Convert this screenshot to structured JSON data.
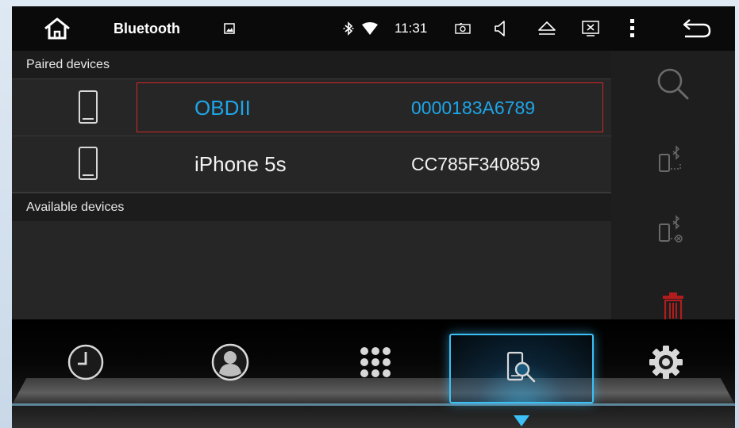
{
  "status_bar": {
    "title": "Bluetooth",
    "time": "11:31",
    "icons": [
      "home-icon",
      "image-icon",
      "bluetooth-icon",
      "wifi-icon",
      "radio-icon",
      "volume-icon",
      "eject-icon",
      "close-app-icon",
      "menu-icon",
      "back-icon"
    ]
  },
  "paired_header": "Paired devices",
  "available_header": "Available devices",
  "devices": [
    {
      "name": "OBDII",
      "address": "0000183A6789",
      "selected": true
    },
    {
      "name": "iPhone 5s",
      "address": "CC785F340859",
      "selected": false
    }
  ],
  "actions": [
    "search-icon",
    "pair-device-icon",
    "unpair-device-icon",
    "delete-icon"
  ],
  "bottom_nav": [
    "call-log-icon",
    "contacts-icon",
    "dialpad-icon",
    "search-devices-icon",
    "settings-icon"
  ],
  "colors": {
    "accent": "#1ea5e8",
    "selection_border": "#d22828",
    "delete": "#b11c1c",
    "nav_glow": "#3cc0f5"
  }
}
